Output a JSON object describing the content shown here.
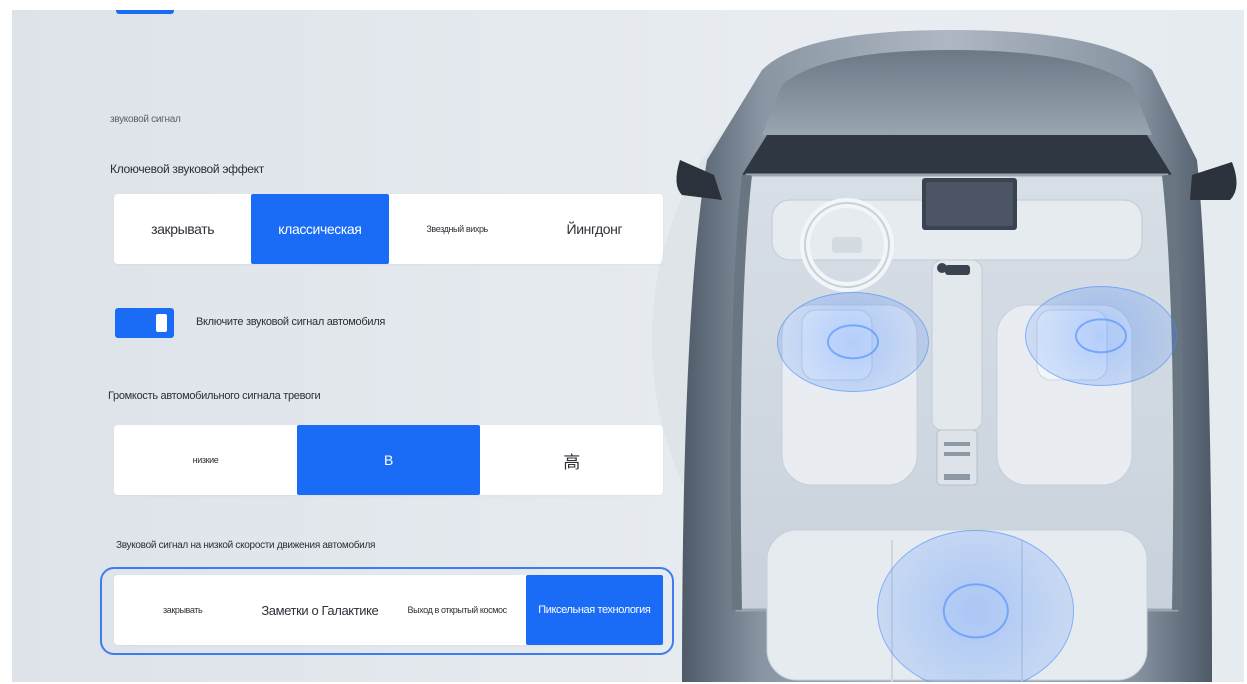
{
  "sound": {
    "section_label": "звуковой сигнал",
    "key_effect": {
      "label": "Клоючевой звуковой эффект",
      "options": [
        "закрывать",
        "классическая",
        "Звездный вихрь",
        "Йингдонг"
      ],
      "selected_index": 1
    },
    "toggle": {
      "label": "Включите звуковой сигнал автомобиля",
      "on": true
    },
    "alarm_volume": {
      "label": "Громкость автомобильного сигнала тревоги",
      "options": [
        "низкие",
        "В",
        "高"
      ],
      "selected_index": 1
    },
    "low_speed": {
      "label": "Звуковой сигнал на низкой скорости движения автомобиля",
      "options": [
        "закрывать",
        "Заметки о Галактике",
        "Выход в открытый космос",
        "Пиксельная технология"
      ],
      "selected_index": 3
    }
  },
  "colors": {
    "accent": "#1a6bf5",
    "panel_bg": "#e4e9ee",
    "speaker_glow": "#3c82ff"
  },
  "icons": {
    "car": "car-top-view-icon",
    "speaker_zones": "speaker-pulse-icon"
  }
}
